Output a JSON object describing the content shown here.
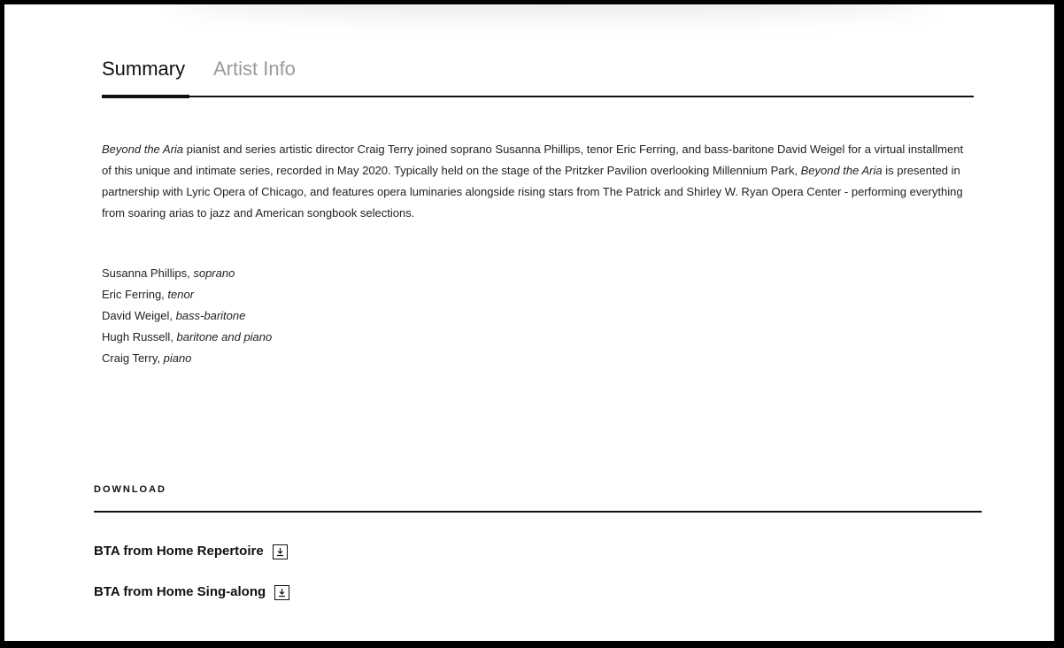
{
  "tabs": {
    "summary": "Summary",
    "artist_info": "Artist Info",
    "active": "summary"
  },
  "summary": {
    "title_italic_1": "Beyond the Aria",
    "text_1": " pianist and series artistic director Craig Terry joined soprano Susanna Phillips, tenor Eric Ferring, and bass-baritone David Weigel for a virtual installment of this unique and intimate series, recorded in May 2020. Typically held on the stage of the Pritzker Pavilion overlooking Millennium Park, ",
    "title_italic_2": "Beyond the Aria",
    "text_2": " is presented in partnership with Lyric Opera of Chicago, and features opera luminaries alongside rising stars from The Patrick and Shirley W. Ryan Opera Center - performing everything from soaring arias to jazz and American songbook selections."
  },
  "credits": [
    {
      "name": "Susanna Phillips, ",
      "role": "soprano"
    },
    {
      "name": "Eric Ferring, ",
      "role": "tenor"
    },
    {
      "name": "David Weigel, ",
      "role": "bass-baritone"
    },
    {
      "name": "Hugh Russell, ",
      "role": "baritone and piano"
    },
    {
      "name": "Craig Terry, ",
      "role": "piano"
    }
  ],
  "download": {
    "heading": "DOWNLOAD",
    "items": [
      {
        "label": "BTA from Home Repertoire",
        "icon": "download-icon"
      },
      {
        "label": "BTA from Home Sing-along",
        "icon": "download-icon"
      }
    ]
  }
}
